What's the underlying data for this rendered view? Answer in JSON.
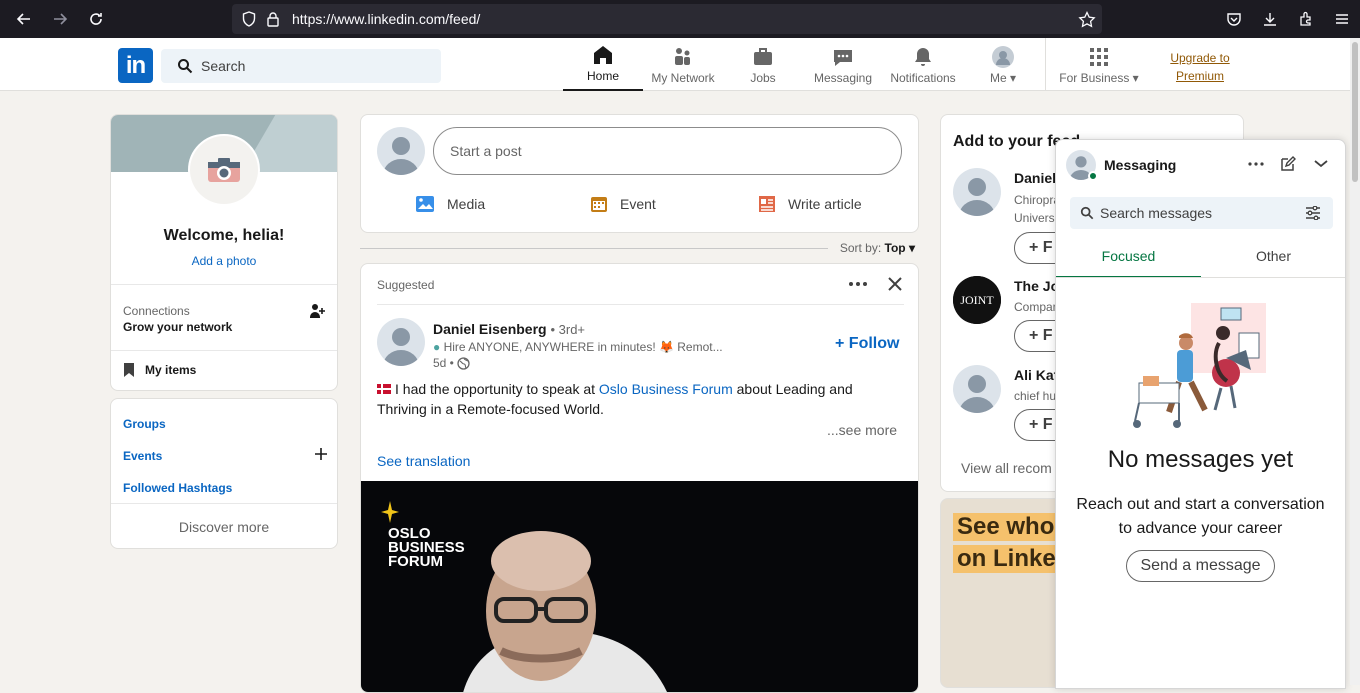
{
  "browser": {
    "url": "https://www.linkedin.com/feed/"
  },
  "header": {
    "logo": "in",
    "search_placeholder": "Search",
    "nav": [
      {
        "label": "Home",
        "icon": "home-icon"
      },
      {
        "label": "My Network",
        "icon": "network-icon"
      },
      {
        "label": "Jobs",
        "icon": "briefcase-icon"
      },
      {
        "label": "Messaging",
        "icon": "chat-icon"
      },
      {
        "label": "Notifications",
        "icon": "bell-icon"
      },
      {
        "label": "Me",
        "icon": "avatar-icon"
      }
    ],
    "for_business": "For Business",
    "upgrade_line1": "Upgrade to",
    "upgrade_line2": "Premium"
  },
  "profile": {
    "welcome": "Welcome, helia!",
    "add_photo": "Add a photo",
    "connections_label": "Connections",
    "connections_sub": "Grow your network",
    "my_items": "My items"
  },
  "links": {
    "groups": "Groups",
    "events": "Events",
    "hashtags": "Followed Hashtags",
    "discover": "Discover more"
  },
  "compose": {
    "start_post": "Start a post",
    "media": "Media",
    "event": "Event",
    "article": "Write article"
  },
  "sort": {
    "label": "Sort by:",
    "value": "Top"
  },
  "post": {
    "suggested": "Suggested",
    "author": "Daniel Eisenberg",
    "degree": "• 3rd+",
    "headline": "Hire ANYONE, ANYWHERE in minutes! 🦊 Remot...",
    "time": "5d •",
    "follow": "+ Follow",
    "text_before": "I had the opportunity to speak at",
    "text_link": "Oslo Business Forum",
    "text_after": "about Leading and Thriving in a Remote-focused World.",
    "see_more": "...see more",
    "see_translation": "See translation",
    "video_brand_1": "OSLO",
    "video_brand_2": "BUSINESS",
    "video_brand_3": "FORUM"
  },
  "feed_add": {
    "title": "Add to your feed",
    "recs": [
      {
        "name": "Daniel",
        "sub1": "Chiropra",
        "sub2": "Universi",
        "btn": "+ F"
      },
      {
        "name": "The Jo",
        "sub1": "Compan",
        "btn": "+ F"
      },
      {
        "name": "Ali Kaf",
        "sub1": "chief hu",
        "btn": "+ F"
      }
    ],
    "view_all": "View all recom"
  },
  "ad": {
    "line1": "See who'",
    "line2": "on Linked"
  },
  "messaging": {
    "title": "Messaging",
    "search_placeholder": "Search messages",
    "tab_focused": "Focused",
    "tab_other": "Other",
    "empty_title": "No messages yet",
    "empty_body": "Reach out and start a conversation to advance your career",
    "send_button": "Send a message"
  }
}
